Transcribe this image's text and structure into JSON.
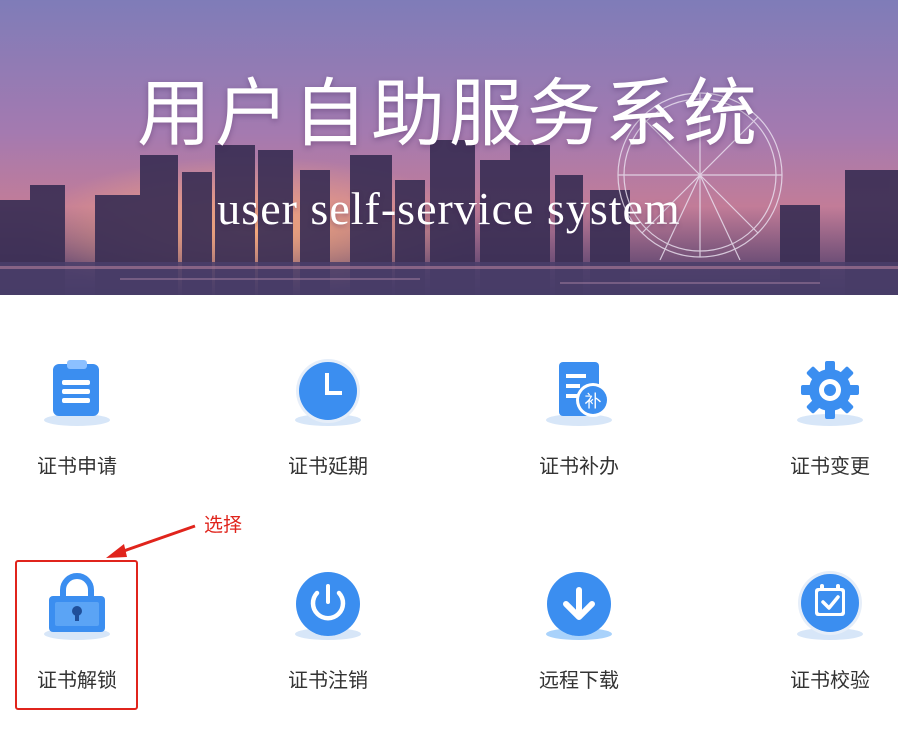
{
  "banner": {
    "title": "用户自助服务系统",
    "subtitle": "user self-service system"
  },
  "services": [
    {
      "label": "证书申请",
      "icon": "clipboard-icon"
    },
    {
      "label": "证书延期",
      "icon": "clock-icon"
    },
    {
      "label": "证书补办",
      "icon": "document-reissue-icon"
    },
    {
      "label": "证书变更",
      "icon": "gear-icon"
    },
    {
      "label": "证书解锁",
      "icon": "padlock-icon"
    },
    {
      "label": "证书注销",
      "icon": "power-icon"
    },
    {
      "label": "远程下载",
      "icon": "download-icon"
    },
    {
      "label": "证书校验",
      "icon": "calendar-check-icon"
    }
  ],
  "annotation": {
    "text": "选择",
    "color": "#e0241c"
  },
  "colors": {
    "icon_blue": "#3b8ef0",
    "icon_shadow": "#d7e6f8",
    "label_text": "#333333"
  }
}
